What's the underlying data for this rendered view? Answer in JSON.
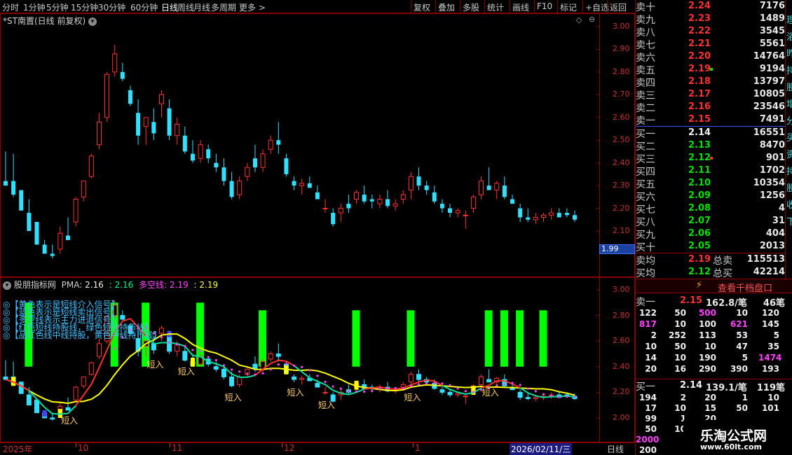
{
  "toolbar": {
    "periods": [
      "分时",
      "1分钟",
      "5分钟",
      "15分钟",
      "30分钟",
      "60分钟",
      "日线",
      "周线",
      "月线",
      "多周期",
      "更多 >"
    ],
    "active_index": 6,
    "actions": [
      "复权",
      "叠加",
      "多股",
      "统计",
      "画线",
      "F10",
      "标记",
      "+自选",
      "返回"
    ]
  },
  "main_chart": {
    "title": "*ST南置(日线 前复权)",
    "yticks": [
      "3.00",
      "2.90",
      "2.80",
      "2.70",
      "2.60",
      "2.50",
      "2.40",
      "2.30",
      "2.20",
      "2.10"
    ],
    "price_box": "1.99",
    "colors": {
      "up": "#ff3030",
      "down": "#30e0ff"
    },
    "candles": [
      [
        2.32,
        2.45,
        2.3,
        2.3
      ],
      [
        2.32,
        2.44,
        2.25,
        2.26
      ],
      [
        2.28,
        2.26,
        2.2,
        2.19
      ],
      [
        2.18,
        2.24,
        2.1,
        2.1
      ],
      [
        2.14,
        2.12,
        2.05,
        2.04
      ],
      [
        2.04,
        2.06,
        2.0,
        2.0
      ],
      [
        2.0,
        2.04,
        1.98,
        1.99
      ],
      [
        2.02,
        2.12,
        2.0,
        2.09
      ],
      [
        2.08,
        2.16,
        2.06,
        2.06
      ],
      [
        2.14,
        2.25,
        2.12,
        2.24
      ],
      [
        2.25,
        2.32,
        2.23,
        2.32
      ],
      [
        2.34,
        2.44,
        2.33,
        2.43
      ],
      [
        2.48,
        2.62,
        2.46,
        2.58
      ],
      [
        2.6,
        2.8,
        2.58,
        2.79
      ],
      [
        2.8,
        2.92,
        2.78,
        2.88
      ],
      [
        2.8,
        2.84,
        2.76,
        2.77
      ],
      [
        2.72,
        2.74,
        2.65,
        2.66
      ],
      [
        2.62,
        2.68,
        2.48,
        2.52
      ],
      [
        2.56,
        2.6,
        2.48,
        2.6
      ],
      [
        2.58,
        2.64,
        2.5,
        2.53
      ],
      [
        2.66,
        2.72,
        2.6,
        2.7
      ],
      [
        2.64,
        2.68,
        2.5,
        2.52
      ],
      [
        2.52,
        2.6,
        2.48,
        2.57
      ],
      [
        2.52,
        2.56,
        2.44,
        2.45
      ],
      [
        2.44,
        2.5,
        2.4,
        2.41
      ],
      [
        2.42,
        2.5,
        2.4,
        2.48
      ],
      [
        2.46,
        2.48,
        2.4,
        2.42
      ],
      [
        2.4,
        2.44,
        2.36,
        2.38
      ],
      [
        2.38,
        2.42,
        2.3,
        2.32
      ],
      [
        2.32,
        2.36,
        2.24,
        2.25
      ],
      [
        2.26,
        2.34,
        2.24,
        2.32
      ],
      [
        2.34,
        2.4,
        2.32,
        2.38
      ],
      [
        2.42,
        2.48,
        2.36,
        2.38
      ],
      [
        2.38,
        2.46,
        2.36,
        2.44
      ],
      [
        2.46,
        2.52,
        2.44,
        2.5
      ],
      [
        2.5,
        2.58,
        2.44,
        2.48
      ],
      [
        2.42,
        2.44,
        2.34,
        2.35
      ],
      [
        2.32,
        2.34,
        2.28,
        2.3
      ],
      [
        2.3,
        2.33,
        2.26,
        2.31
      ],
      [
        2.31,
        2.34,
        2.29,
        2.29
      ],
      [
        2.27,
        2.3,
        2.24,
        2.24
      ],
      [
        2.2,
        2.24,
        2.18,
        2.2
      ],
      [
        2.18,
        2.2,
        2.12,
        2.13
      ],
      [
        2.18,
        2.22,
        2.14,
        2.2
      ],
      [
        2.22,
        2.26,
        2.18,
        2.2
      ],
      [
        2.24,
        2.28,
        2.22,
        2.27
      ],
      [
        2.26,
        2.3,
        2.22,
        2.23
      ],
      [
        2.24,
        2.26,
        2.2,
        2.23
      ],
      [
        2.22,
        2.26,
        2.2,
        2.24
      ],
      [
        2.24,
        2.28,
        2.2,
        2.21
      ],
      [
        2.21,
        2.24,
        2.19,
        2.22
      ],
      [
        2.24,
        2.28,
        2.22,
        2.26
      ],
      [
        2.28,
        2.36,
        2.24,
        2.34
      ],
      [
        2.34,
        2.38,
        2.28,
        2.3
      ],
      [
        2.3,
        2.32,
        2.26,
        2.28
      ],
      [
        2.27,
        2.3,
        2.22,
        2.23
      ],
      [
        2.22,
        2.24,
        2.18,
        2.2
      ],
      [
        2.2,
        2.22,
        2.16,
        2.18
      ],
      [
        2.18,
        2.2,
        2.16,
        2.19
      ],
      [
        2.17,
        2.19,
        2.11,
        2.17
      ],
      [
        2.2,
        2.26,
        2.18,
        2.25
      ],
      [
        2.26,
        2.34,
        2.24,
        2.32
      ],
      [
        2.3,
        2.38,
        2.28,
        2.28
      ],
      [
        2.28,
        2.32,
        2.24,
        2.31
      ],
      [
        2.3,
        2.34,
        2.24,
        2.25
      ],
      [
        2.24,
        2.26,
        2.22,
        2.22
      ],
      [
        2.2,
        2.22,
        2.14,
        2.16
      ],
      [
        2.16,
        2.2,
        2.14,
        2.15
      ],
      [
        2.15,
        2.18,
        2.13,
        2.16
      ],
      [
        2.16,
        2.18,
        2.14,
        2.17
      ],
      [
        2.17,
        2.2,
        2.15,
        2.18
      ],
      [
        2.18,
        2.2,
        2.16,
        2.16
      ],
      [
        2.18,
        2.2,
        2.16,
        2.17
      ],
      [
        2.17,
        2.19,
        2.14,
        2.15
      ]
    ]
  },
  "indicator": {
    "title": "股朋指标网",
    "pma_label": "PMA:",
    "pma_value": "2.16",
    "colon2": ":",
    "val2": "2.16",
    "dk_label": "多空线:",
    "dk_value": "2.19",
    "colon4": ":",
    "val4": "2.19",
    "yticks": [
      "3.00",
      "2.80",
      "2.60",
      "2.40",
      "2.20",
      "2.00"
    ],
    "legend": [
      "◎【黄色表示是短线介入信号】",
      "◎【蓝色表示是短线卖出信号】",
      "◎【多空线表示主力进退信号】",
      "◎【红色短线持股线，绿色短线持币线】",
      "◎【品红色线中线持股，黄色中线持币线】"
    ],
    "signal_text": "短入",
    "colors": {
      "bar": "#00ff00",
      "pma": "#ffff00",
      "dk_red": "#ff3030",
      "dk_green": "#00e0a0",
      "mid": "#ff40ff"
    }
  },
  "date_axis": {
    "labels": [
      "2025年",
      "10",
      "11",
      "12",
      "1"
    ],
    "cursor": "2026/02/11/三",
    "mode": "日线"
  },
  "orderbook": {
    "sells": [
      {
        "name": "卖十",
        "price": "2.24",
        "vol": "7176",
        "color": "red"
      },
      {
        "name": "卖九",
        "price": "2.23",
        "vol": "1489",
        "color": "red"
      },
      {
        "name": "卖八",
        "price": "2.22",
        "vol": "3545",
        "color": "red"
      },
      {
        "name": "卖七",
        "price": "2.21",
        "vol": "5561",
        "color": "red"
      },
      {
        "name": "卖六",
        "price": "2.20",
        "vol": "14764",
        "color": "red"
      },
      {
        "name": "卖五",
        "price": "2.19",
        "vol": "9194",
        "color": "red"
      },
      {
        "name": "卖四",
        "price": "2.18",
        "vol": "13797",
        "color": "red"
      },
      {
        "name": "卖三",
        "price": "2.17",
        "vol": "10805",
        "color": "red"
      },
      {
        "name": "卖二",
        "price": "2.16",
        "vol": "23546",
        "color": "red"
      },
      {
        "name": "卖一",
        "price": "2.15",
        "vol": "7491",
        "color": "red"
      }
    ],
    "buys": [
      {
        "name": "买一",
        "price": "2.14",
        "vol": "16551",
        "color": "white"
      },
      {
        "name": "买二",
        "price": "2.13",
        "vol": "8470",
        "color": "green"
      },
      {
        "name": "买三",
        "price": "2.12",
        "vol": "901",
        "color": "green"
      },
      {
        "name": "买四",
        "price": "2.11",
        "vol": "1702",
        "color": "green"
      },
      {
        "name": "买五",
        "price": "2.10",
        "vol": "10354",
        "color": "green"
      },
      {
        "name": "买六",
        "price": "2.09",
        "vol": "1256",
        "color": "green"
      },
      {
        "name": "买七",
        "price": "2.08",
        "vol": "4",
        "color": "green"
      },
      {
        "name": "买八",
        "price": "2.07",
        "vol": "31",
        "color": "green"
      },
      {
        "name": "买九",
        "price": "2.06",
        "vol": "404",
        "color": "green"
      },
      {
        "name": "买十",
        "price": "2.05",
        "vol": "2013",
        "color": "green"
      }
    ],
    "sell_avg": {
      "name": "卖均",
      "price": "2.19",
      "label": "总卖",
      "vol": "115513"
    },
    "buy_avg": {
      "name": "买均",
      "price": "2.12",
      "label": "总买",
      "vol": "42214"
    },
    "depth_button": "查看千档盘口",
    "sell1_summary": {
      "name": "卖一",
      "price": "2.15",
      "avg": "162.8/笔",
      "count": "46笔"
    },
    "sell_queue": [
      [
        "122",
        "50",
        "500",
        "10",
        "120"
      ],
      [
        "817",
        "10",
        "100",
        "621",
        "145"
      ],
      [
        "2",
        "252",
        "113",
        "53",
        "5"
      ],
      [
        "10",
        "50",
        "10",
        "47",
        "35"
      ],
      [
        "14",
        "10",
        "190",
        "5",
        "1474"
      ],
      [
        "20",
        "16",
        "290",
        "390",
        "193"
      ]
    ],
    "sell_queue_colors": [
      [
        "white",
        "white",
        "magenta",
        "white",
        "white"
      ],
      [
        "magenta",
        "white",
        "white",
        "magenta",
        "white"
      ],
      [
        "white",
        "white",
        "white",
        "white",
        "white"
      ],
      [
        "white",
        "white",
        "white",
        "white",
        "white"
      ],
      [
        "white",
        "white",
        "white",
        "white",
        "magenta"
      ],
      [
        "white",
        "white",
        "white",
        "white",
        "white"
      ]
    ],
    "buy1_summary": {
      "name": "买一",
      "price": "2.14",
      "avg": "139.1/笔",
      "count": "119笔"
    },
    "buy_queue": [
      [
        "194",
        "2",
        "20",
        "1",
        "10"
      ],
      [
        "17",
        "10",
        "15",
        "50",
        "101"
      ],
      [
        "99",
        "1",
        "20",
        "",
        ""
      ],
      [
        "50",
        "10",
        "",
        "",
        ""
      ],
      [
        "2000",
        "",
        "",
        "",
        ""
      ],
      [
        "200",
        "",
        "",
        "",
        ""
      ]
    ]
  },
  "watermark": {
    "title": "乐淘公式网",
    "url": "www.60lt.com"
  },
  "side_strip": [
    "理",
    "浴",
    "昨",
    "持",
    "股",
    "增",
    "分",
    "买",
    "资",
    "持",
    "股",
    "收",
    "下"
  ]
}
